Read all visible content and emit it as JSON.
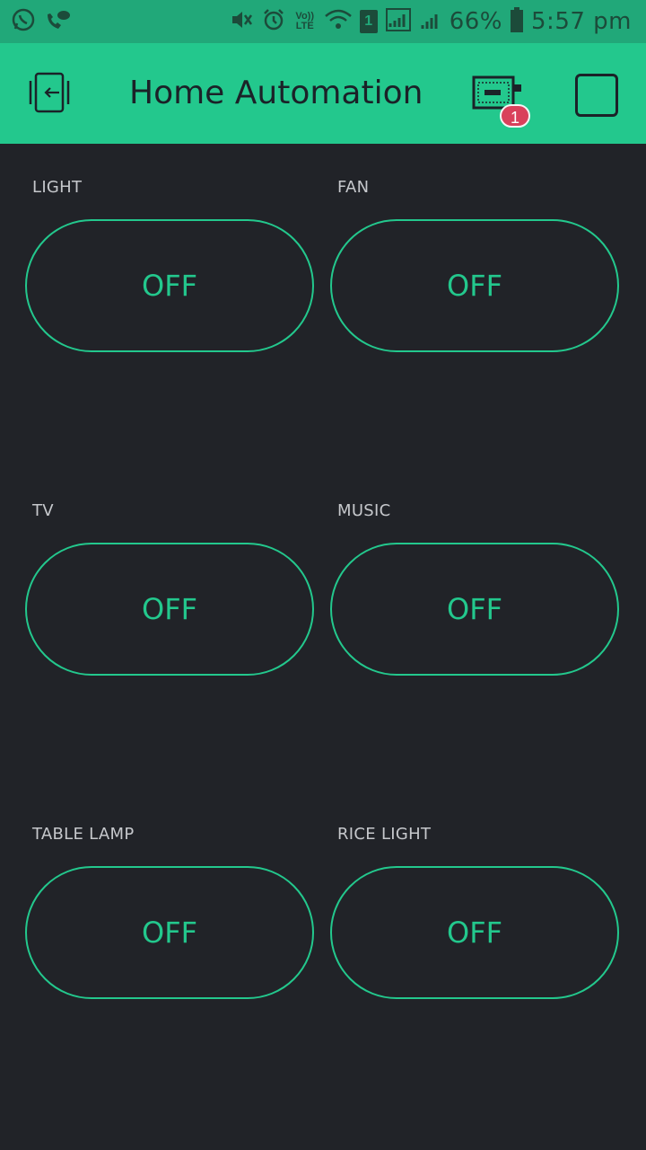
{
  "status_bar": {
    "battery_text": "66%",
    "time": "5:57 pm",
    "sim_slot": "1",
    "volte_label": "Vo)) LTE",
    "icons": [
      "whatsapp-icon",
      "phone-chat-icon",
      "mute-icon",
      "alarm-icon",
      "volte-icon",
      "wifi-icon",
      "sim-icon",
      "signal-icon",
      "signal-icon-2",
      "battery-icon"
    ]
  },
  "app_bar": {
    "title": "Home Automation",
    "device_badge_count": "1",
    "icons": {
      "back": "exit-icon",
      "device": "device-board-icon",
      "stop": "stop-icon"
    }
  },
  "widgets": [
    {
      "label": "LIGHT",
      "state": "OFF"
    },
    {
      "label": "FAN",
      "state": "OFF"
    },
    {
      "label": "TV",
      "state": "OFF"
    },
    {
      "label": "MUSIC",
      "state": "OFF"
    },
    {
      "label": "TABLE LAMP",
      "state": "OFF"
    },
    {
      "label": "RICE LIGHT",
      "state": "OFF"
    }
  ],
  "colors": {
    "accent": "#23c88d",
    "background": "#212328",
    "status_bar": "#21a879",
    "badge": "#d9415b"
  }
}
